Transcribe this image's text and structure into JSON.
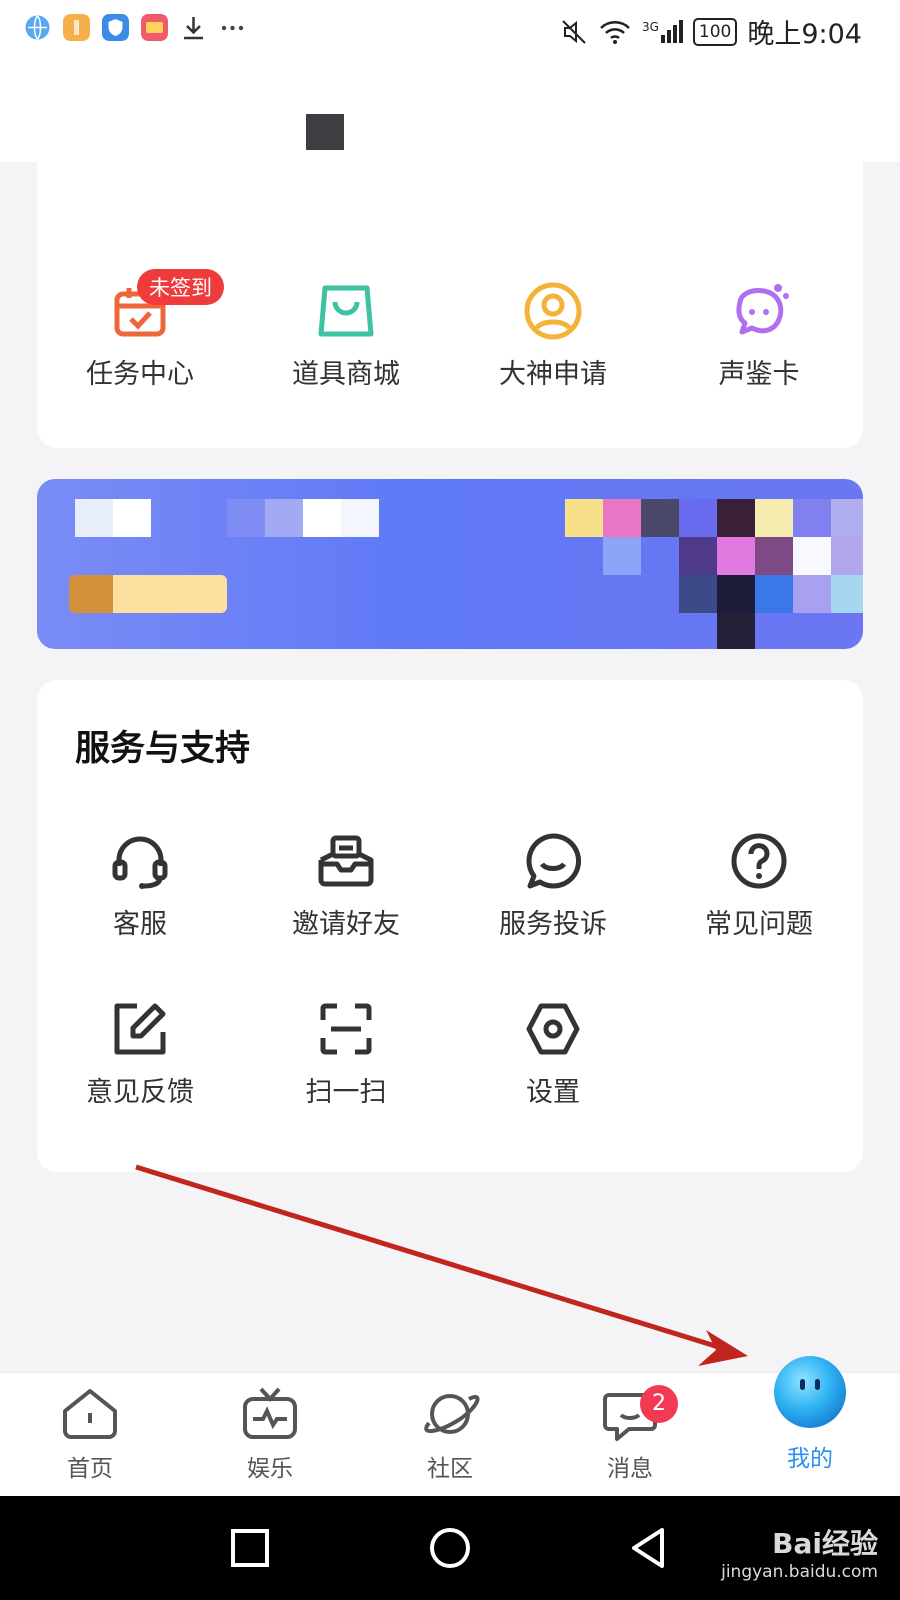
{
  "status_bar": {
    "time": "晚上9:04",
    "battery": "100",
    "network": "3G"
  },
  "tasks": [
    {
      "label": "任务中心",
      "icon": "calendar-check-icon",
      "badge": "未签到"
    },
    {
      "label": "道具商城",
      "icon": "shopping-bag-icon"
    },
    {
      "label": "大神申请",
      "icon": "user-circle-icon"
    },
    {
      "label": "声鉴卡",
      "icon": "voice-card-icon"
    }
  ],
  "services": {
    "title": "服务与支持",
    "items": [
      {
        "label": "客服",
        "icon": "headset-icon"
      },
      {
        "label": "邀请好友",
        "icon": "invite-mail-icon"
      },
      {
        "label": "服务投诉",
        "icon": "chat-bubble-icon"
      },
      {
        "label": "常见问题",
        "icon": "question-circle-icon"
      },
      {
        "label": "意见反馈",
        "icon": "edit-note-icon"
      },
      {
        "label": "扫一扫",
        "icon": "scan-icon"
      },
      {
        "label": "设置",
        "icon": "settings-hexagon-icon"
      }
    ]
  },
  "bottom_nav": [
    {
      "label": "首页",
      "icon": "home-icon"
    },
    {
      "label": "娱乐",
      "icon": "tv-pulse-icon"
    },
    {
      "label": "社区",
      "icon": "planet-icon"
    },
    {
      "label": "消息",
      "icon": "message-icon",
      "badge": "2"
    },
    {
      "label": "我的",
      "icon": "avatar-blob-icon",
      "active": true
    }
  ],
  "watermark": {
    "main": "Bai经验",
    "sub": "jingyan.baidu.com"
  },
  "colors": {
    "accent": "#2a8ff0",
    "badge_red": "#ee3b3b",
    "arrow": "#c0261d"
  }
}
